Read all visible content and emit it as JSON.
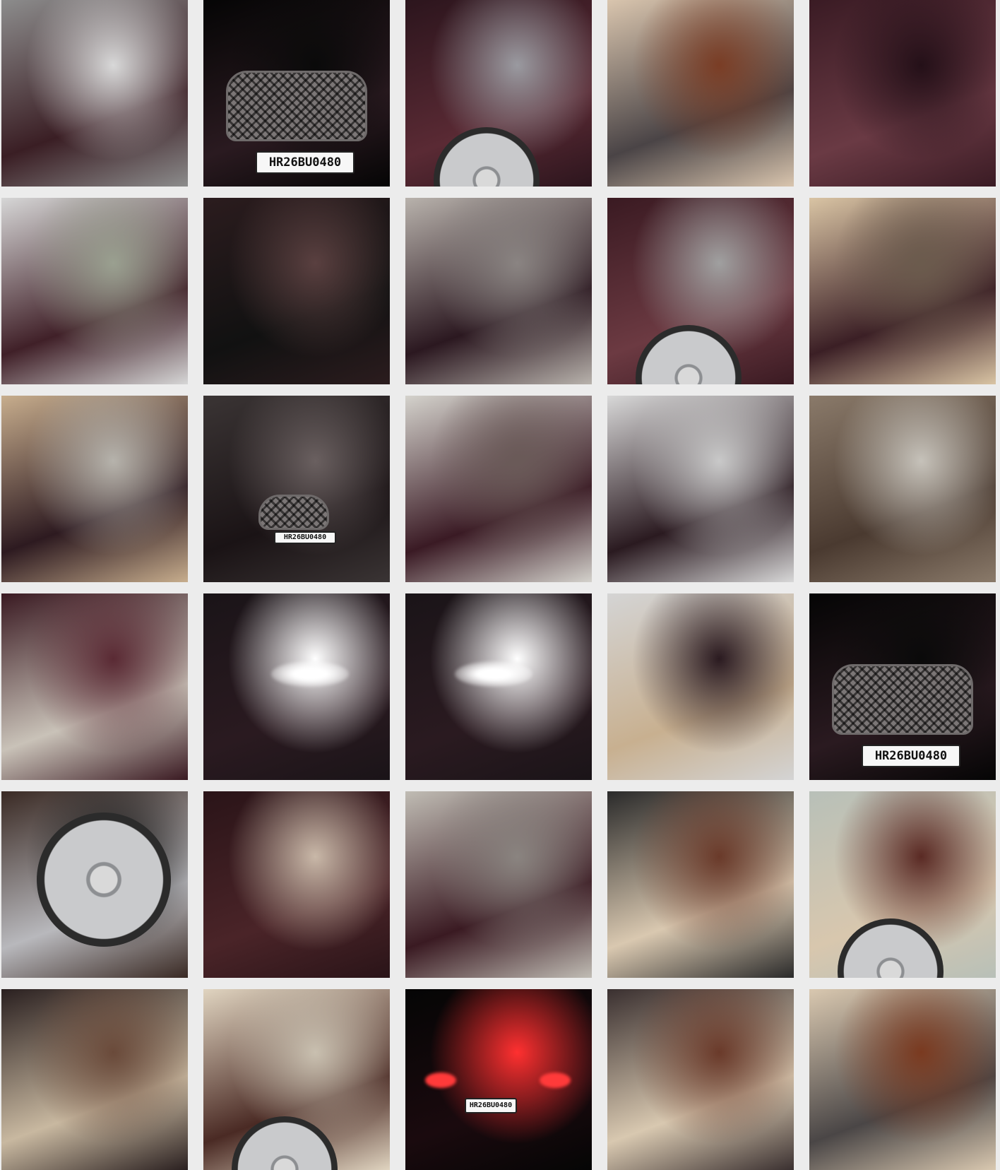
{
  "gallery": {
    "plate_text": "HR26BU0480",
    "rows": 6,
    "columns": 5,
    "tiles": [
      {
        "subject": "rear three-quarter view with tail lights in parking garage",
        "colors": [
          "#8c8c8c",
          "#3a1e24",
          "#d8d8d8"
        ]
      },
      {
        "subject": "front grille and license plate at night",
        "colors": [
          "#050505",
          "#2a1a20",
          "#0a0a0a"
        ],
        "plate": true
      },
      {
        "subject": "rear quarter panel with fuel cap and wheel",
        "colors": [
          "#2c151d",
          "#5a2a34",
          "#9a9aa0"
        ]
      },
      {
        "subject": "center console with wood trim",
        "colors": [
          "#d9c5ae",
          "#4a4446",
          "#7a3d25"
        ]
      },
      {
        "subject": "close up of paint scratch on quarter panel",
        "colors": [
          "#3a1b24",
          "#6a3a44",
          "#241018"
        ]
      },
      {
        "subject": "rear windshield and cabin from behind",
        "colors": [
          "#d6d6d6",
          "#402028",
          "#9aa090"
        ]
      },
      {
        "subject": "open boot with items",
        "colors": [
          "#2b1c1e",
          "#111111",
          "#5a4040"
        ]
      },
      {
        "subject": "side of car near open door",
        "colors": [
          "#b8b2ac",
          "#2b1820",
          "#8a8482"
        ]
      },
      {
        "subject": "rear door and wheel",
        "colors": [
          "#3a1a22",
          "#6c3a42",
          "#a0a0a0"
        ]
      },
      {
        "subject": "rear seats through door opening with sticker",
        "colors": [
          "#d9c4a4",
          "#3b1f25",
          "#6b5b4d"
        ]
      },
      {
        "subject": "interior with door open and sticker",
        "colors": [
          "#c7ad8d",
          "#2d1a20",
          "#b6b3ac"
        ]
      },
      {
        "subject": "front view with headlights on",
        "colors": [
          "#3a3434",
          "#1a1315",
          "#6a6060"
        ],
        "plate": true
      },
      {
        "subject": "underside of open boot lid",
        "colors": [
          "#d4d2cc",
          "#3a1a24",
          "#6a5a58"
        ]
      },
      {
        "subject": "bonnet and windshield in parking garage",
        "colors": [
          "#d8d8d8",
          "#2a1a20",
          "#c9c9c9"
        ]
      },
      {
        "subject": "underside of open bonnet insulation",
        "colors": [
          "#8a7a6a",
          "#4a3a30",
          "#c6c2ba"
        ]
      },
      {
        "subject": "side doors and windows",
        "colors": [
          "#3a1a22",
          "#c9c2b8",
          "#5a2a34"
        ]
      },
      {
        "subject": "left headlight at night",
        "colors": [
          "#1a1418",
          "#2a1a20",
          "#ffffff"
        ]
      },
      {
        "subject": "right headlight at night",
        "colors": [
          "#1a1418",
          "#2a1a20",
          "#ffffff"
        ]
      },
      {
        "subject": "cabin through windshield",
        "colors": [
          "#d4d4d4",
          "#c8b090",
          "#2a1a20"
        ]
      },
      {
        "subject": "front grille and plate at night",
        "colors": [
          "#050505",
          "#2a1a20",
          "#0a0a0a"
        ],
        "plate": true
      },
      {
        "subject": "alloy wheel and tyre",
        "colors": [
          "#3a2a24",
          "#b8b8bc",
          "#1a1a1a"
        ]
      },
      {
        "subject": "scratched front bumper below headlight",
        "colors": [
          "#2a1418",
          "#4a2428",
          "#c9b8a8"
        ]
      },
      {
        "subject": "side profile low angle",
        "colors": [
          "#c0bcb4",
          "#3a1a22",
          "#8a8480"
        ]
      },
      {
        "subject": "front door interior panel open",
        "colors": [
          "#2a2a2a",
          "#d9c8b0",
          "#6a3a2a"
        ]
      },
      {
        "subject": "rear door interior panel open",
        "colors": [
          "#b8c0b8",
          "#d8c7ae",
          "#5a2a24"
        ]
      },
      {
        "subject": "driver door panel and dashboard",
        "colors": [
          "#2a2020",
          "#c8b8a0",
          "#6a4a3a"
        ]
      },
      {
        "subject": "front seats and steering wheel",
        "colors": [
          "#e0d4c0",
          "#4a2a24",
          "#c9c0b0"
        ]
      },
      {
        "subject": "rear tail lights and plate at night",
        "colors": [
          "#050505",
          "#1a0a0e",
          "#ff3030"
        ],
        "plate": true
      },
      {
        "subject": "door interior panel with wood trim",
        "colors": [
          "#3a3030",
          "#d8c8b0",
          "#6a3a2a"
        ]
      },
      {
        "subject": "center console and dashboard",
        "colors": [
          "#d9c8b0",
          "#4a4646",
          "#7a3a20"
        ]
      }
    ]
  }
}
